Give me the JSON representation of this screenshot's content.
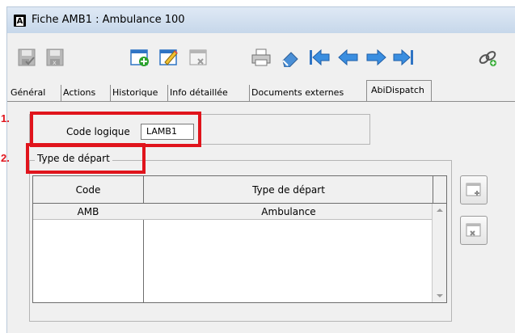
{
  "window": {
    "title": "Fiche AMB1 : Ambulance 100",
    "logo_letter": "A"
  },
  "toolbar": {
    "buttons": [
      {
        "name": "save-close-icon",
        "enabled": false
      },
      {
        "name": "save-icon",
        "enabled": false
      },
      {
        "name": "new-record-icon",
        "enabled": true
      },
      {
        "name": "edit-icon",
        "enabled": true
      },
      {
        "name": "delete-icon",
        "enabled": false
      },
      {
        "name": "print-icon",
        "enabled": true
      },
      {
        "name": "clear-icon",
        "enabled": true
      },
      {
        "name": "first-record-icon",
        "enabled": true
      },
      {
        "name": "previous-record-icon",
        "enabled": true
      },
      {
        "name": "next-record-icon",
        "enabled": true
      },
      {
        "name": "last-record-icon",
        "enabled": true
      },
      {
        "name": "link-icon",
        "enabled": true
      }
    ]
  },
  "tabs": [
    {
      "label": "Général"
    },
    {
      "label": "Actions"
    },
    {
      "label": "Historique"
    },
    {
      "label": "Info détaillée"
    },
    {
      "label": "Documents externes"
    },
    {
      "label": "AbiDispatch",
      "active": true
    }
  ],
  "form": {
    "code_logique_label": "Code logique",
    "code_logique_value": "LAMB1"
  },
  "group": {
    "legend": "Type de départ",
    "columns": [
      "Code",
      "Type de départ"
    ],
    "rows": [
      {
        "code": "AMB",
        "type": "Ambulance"
      }
    ]
  },
  "annotations": {
    "marker1": "1.",
    "marker2": "2.",
    "color": "#e0141c"
  }
}
